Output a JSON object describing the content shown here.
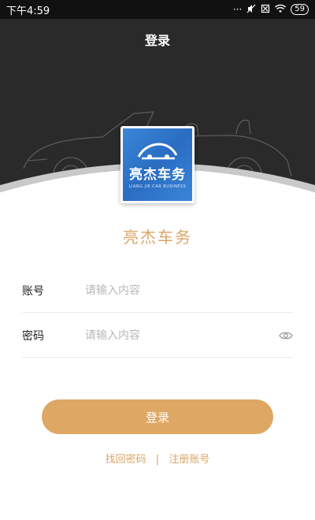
{
  "status_bar": {
    "time": "下午4:59",
    "dots": "···",
    "battery": "59"
  },
  "header": {
    "title": "登录"
  },
  "logo": {
    "name": "亮杰车务",
    "subtitle": "LIANG JIE CAR BUSINESS"
  },
  "brand": {
    "name": "亮杰车务"
  },
  "form": {
    "account_label": "账号",
    "account_placeholder": "请输入内容",
    "password_label": "密码",
    "password_placeholder": "请输入内容"
  },
  "actions": {
    "login_label": "登录",
    "forgot_password": "找回密码",
    "separator": "|",
    "register": "注册账号"
  },
  "colors": {
    "accent": "#dfa764",
    "header_bg": "#2a2a2a",
    "logo_bg": "#2f78cf"
  }
}
